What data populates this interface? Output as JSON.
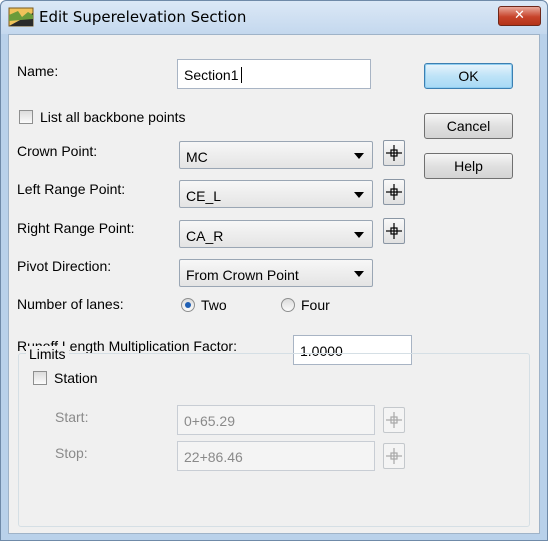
{
  "window": {
    "title": "Edit Superelevation Section",
    "close_glyph": "✕"
  },
  "form": {
    "name_label": "Name:",
    "name_value": "Section1",
    "list_all_label": "List all backbone points",
    "list_all_checked": false,
    "crown_label": "Crown Point:",
    "crown_value": "MC",
    "left_range_label": "Left Range Point:",
    "left_range_value": "CE_L",
    "right_range_label": "Right Range Point:",
    "right_range_value": "CA_R",
    "pivot_label": "Pivot Direction:",
    "pivot_value": "From Crown Point",
    "lanes_label": "Number of lanes:",
    "lanes_options": [
      "Two",
      "Four"
    ],
    "lanes_selected": "Two",
    "runoff_label": "Runoff Length Multiplication Factor:",
    "runoff_value": "1.0000"
  },
  "limits": {
    "group_label": "Limits",
    "station_label": "Station",
    "station_checked": false,
    "start_label": "Start:",
    "start_value": "0+65.29",
    "stop_label": "Stop:",
    "stop_value": "22+86.46"
  },
  "buttons": {
    "ok": "OK",
    "cancel": "Cancel",
    "help": "Help"
  },
  "icons": {
    "app": "superelevation-app-icon",
    "pick": "crosshair-target-icon",
    "dropdown": "chevron-down-icon",
    "close": "close-icon"
  },
  "colors": {
    "title_bar": "#c4d8ee",
    "close_button": "#c7432a",
    "default_button": "#bee3f7",
    "dialog_bg": "#f0f0f0",
    "disabled_text": "#8a8a8a"
  }
}
